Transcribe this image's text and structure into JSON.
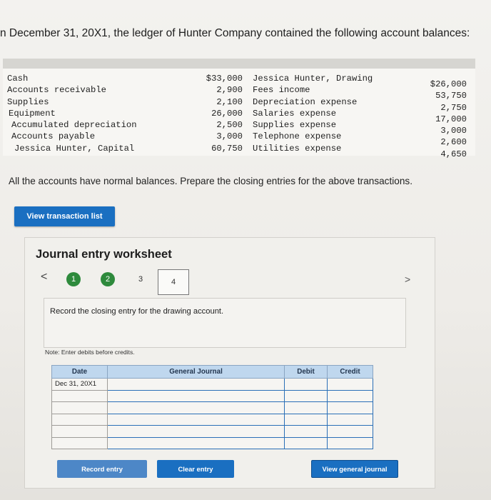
{
  "heading": "n December 31, 20X1, the ledger of Hunter Company contained the following account balances:",
  "ledger": {
    "left": [
      {
        "name": "Cash",
        "amount": "$33,000"
      },
      {
        "name": "Accounts receivable",
        "amount": "2,900"
      },
      {
        "name": "Supplies",
        "amount": "2,100"
      },
      {
        "name": "Equipment",
        "amount": "26,000"
      },
      {
        "name": "Accumulated depreciation",
        "amount": "2,500"
      },
      {
        "name": "Accounts payable",
        "amount": "3,000"
      },
      {
        "name": "Jessica Hunter, Capital",
        "amount": "60,750"
      }
    ],
    "right": [
      {
        "name": "Jessica Hunter, Drawing",
        "amount": "$26,000"
      },
      {
        "name": "Fees income",
        "amount": "53,750"
      },
      {
        "name": "Depreciation expense",
        "amount": "2,750"
      },
      {
        "name": "Salaries expense",
        "amount": "17,000"
      },
      {
        "name": "Supplies expense",
        "amount": "3,000"
      },
      {
        "name": "Telephone expense",
        "amount": "2,600"
      },
      {
        "name": "Utilities expense",
        "amount": "4,650"
      }
    ]
  },
  "instruction": "All the accounts have normal balances. Prepare the closing entries for the above transactions.",
  "view_transaction_label": "View transaction list",
  "worksheet": {
    "title": "Journal entry worksheet",
    "nav_prev": "<",
    "nav_next": ">",
    "steps": [
      "1",
      "2",
      "3",
      "4"
    ],
    "task": "Record the closing entry for the drawing account.",
    "note": "Note: Enter debits before credits.",
    "table": {
      "headers": {
        "date": "Date",
        "journal": "General Journal",
        "debit": "Debit",
        "credit": "Credit"
      },
      "first_date": "Dec 31, 20X1"
    },
    "buttons": {
      "record": "Record entry",
      "clear": "Clear entry",
      "view_general": "View general journal"
    }
  },
  "colors": {
    "accent": "#1a6fc1",
    "step_done": "#2e8a3c",
    "header_bg": "#bfd7ee"
  }
}
